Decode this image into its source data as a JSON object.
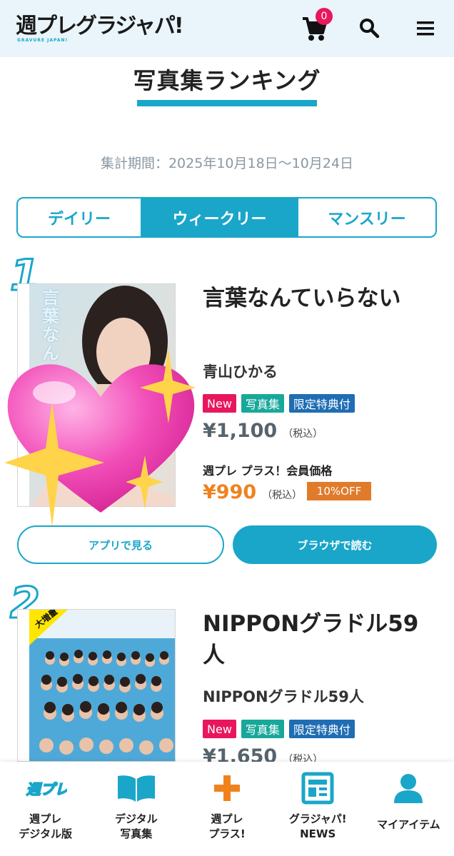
{
  "header": {
    "logo_text": "週プレグラジャパ!",
    "logo_subtext": "GRAVURE JAPAN!",
    "cart_count": "0",
    "icons": [
      "cart-icon",
      "search-icon",
      "menu-icon"
    ]
  },
  "page": {
    "title": "写真集ランキング",
    "period": "集計期間：2025年10月18日〜10月24日"
  },
  "tabs": [
    {
      "label": "デイリー",
      "active": false
    },
    {
      "label": "ウィークリー",
      "active": true
    },
    {
      "label": "マンスリー",
      "active": false
    }
  ],
  "items": [
    {
      "rank": "1",
      "title": "言葉なんていらない",
      "author": "青山ひかる",
      "badges": [
        "New",
        "写真集",
        "限定特典付"
      ],
      "price": "¥1,100",
      "tax_note": "（税込）",
      "member_label": "週プレ プラス！会員価格",
      "member_price": "¥990",
      "discount": "10%OFF",
      "cover_text": "言葉なんていらない",
      "btn_app": "アプリで見る",
      "btn_browser": "ブラウザで読む"
    },
    {
      "rank": "2",
      "title": "NIPPONグラドル59人",
      "author": "NIPPONグラドル59人",
      "badges": [
        "New",
        "写真集",
        "限定特典付"
      ],
      "price": "¥1,650",
      "tax_note": "（税込）",
      "cover_banner": "大増量"
    }
  ],
  "bottom_nav": [
    {
      "label": "週プレ\nデジタル版",
      "icon": "weekly-logo-icon"
    },
    {
      "label": "デジタル\n写真集",
      "icon": "book-icon"
    },
    {
      "label": "週プレ\nプラス!",
      "icon": "plus-icon"
    },
    {
      "label": "グラジャパ!\nNEWS",
      "icon": "news-icon"
    },
    {
      "label": "マイアイテム",
      "icon": "user-icon"
    }
  ],
  "colors": {
    "accent": "#1aa6c9",
    "header_bg": "#e9f5fb",
    "new_badge": "#e8175d",
    "photo_badge": "#18a89a",
    "limited_badge": "#1f6db3",
    "member_price": "#f0821e",
    "discount_badge": "#e07b2b"
  }
}
